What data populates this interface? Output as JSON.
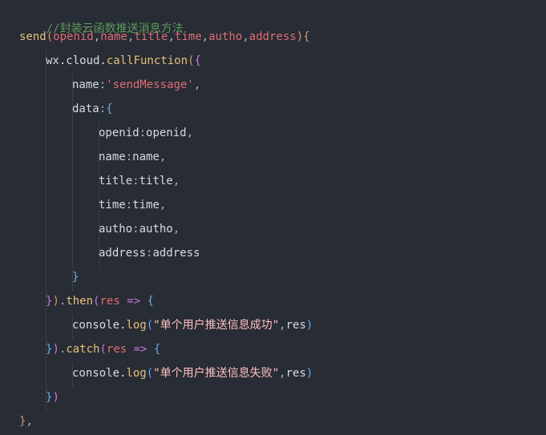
{
  "editor": {
    "comment": "//封装云函数推送消息方法",
    "fn_name": "send",
    "params": [
      "openid",
      "name",
      "title",
      "time",
      "autho",
      "address"
    ],
    "call": {
      "object": "wx.cloud.",
      "method": "callFunction",
      "name_key": "name",
      "name_value": "'sendMessage'",
      "data_key": "data",
      "fields": [
        {
          "key": "openid",
          "value": "openid",
          "sep": ","
        },
        {
          "key": "name",
          "value": "name",
          "sep": ","
        },
        {
          "key": "title",
          "value": "title",
          "sep": ","
        },
        {
          "key": "time",
          "value": "time",
          "sep": ","
        },
        {
          "key": "autho",
          "value": "autho",
          "sep": ","
        },
        {
          "key": "address",
          "value": "address",
          "sep": ""
        }
      ]
    },
    "then": {
      "method": "then",
      "arg": "res",
      "console": "console.",
      "log": "log",
      "message": "\"单个用户推送信息成功\"",
      "res": "res"
    },
    "catch": {
      "method": "catch",
      "arg": "res",
      "console": "console.",
      "log": "log",
      "message": "\"单个用户推送信息失败\"",
      "res": "res"
    }
  }
}
